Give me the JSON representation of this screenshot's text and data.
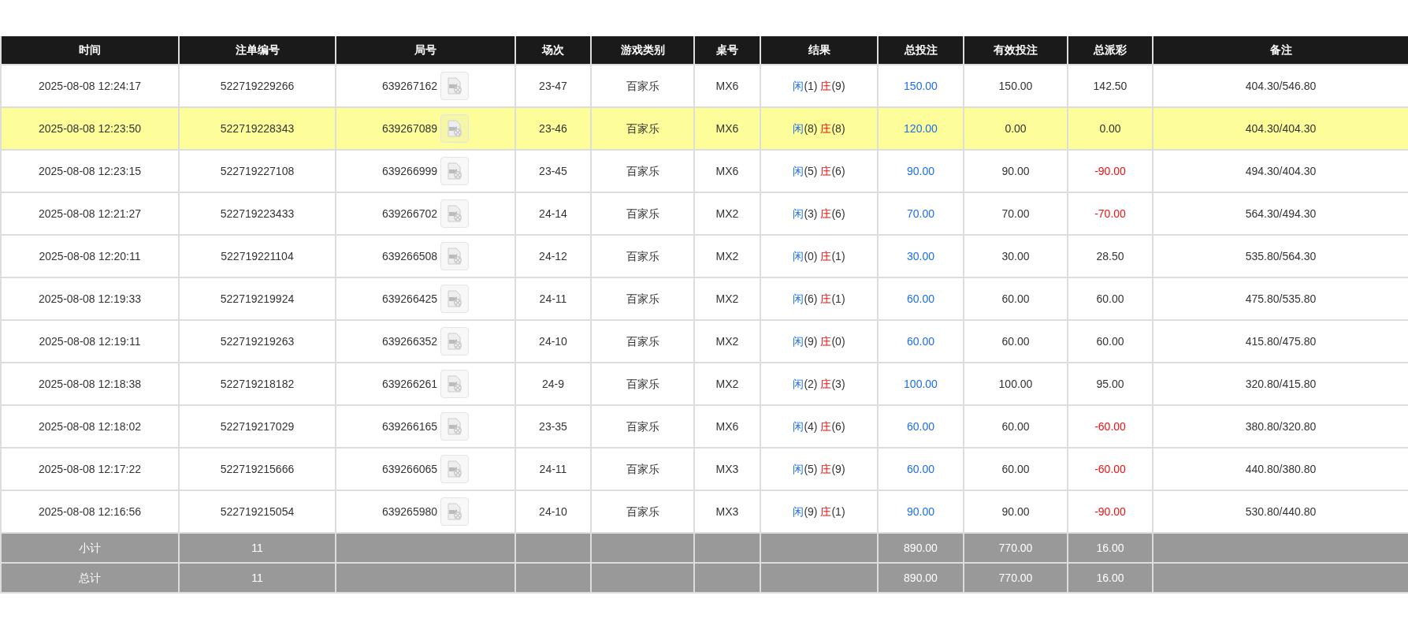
{
  "table": {
    "columns": [
      "时间",
      "注单编号",
      "局号",
      "场次",
      "游戏类别",
      "桌号",
      "结果",
      "总投注",
      "有效投注",
      "总派彩",
      "备注"
    ],
    "rows": [
      {
        "selected": false,
        "time": "2025-08-08 12:24:17",
        "bet_no": "522719229266",
        "round_no": "639267162",
        "session": "23-47",
        "game": "百家乐",
        "table": "MX6",
        "player": {
          "label": "闲",
          "score": "(1)"
        },
        "banker": {
          "label": "庄",
          "score": "(9)"
        },
        "total_bet": "150.00",
        "valid_bet": "150.00",
        "payout": "142.50",
        "payout_negative": false,
        "remark": "404.30/546.80"
      },
      {
        "selected": true,
        "time": "2025-08-08 12:23:50",
        "bet_no": "522719228343",
        "round_no": "639267089",
        "session": "23-46",
        "game": "百家乐",
        "table": "MX6",
        "player": {
          "label": "闲",
          "score": "(8)"
        },
        "banker": {
          "label": "庄",
          "score": "(8)"
        },
        "total_bet": "120.00",
        "valid_bet": "0.00",
        "payout": "0.00",
        "payout_negative": false,
        "remark": "404.30/404.30"
      },
      {
        "selected": false,
        "time": "2025-08-08 12:23:15",
        "bet_no": "522719227108",
        "round_no": "639266999",
        "session": "23-45",
        "game": "百家乐",
        "table": "MX6",
        "player": {
          "label": "闲",
          "score": "(5)"
        },
        "banker": {
          "label": "庄",
          "score": "(6)"
        },
        "total_bet": "90.00",
        "valid_bet": "90.00",
        "payout": "-90.00",
        "payout_negative": true,
        "remark": "494.30/404.30"
      },
      {
        "selected": false,
        "time": "2025-08-08 12:21:27",
        "bet_no": "522719223433",
        "round_no": "639266702",
        "session": "24-14",
        "game": "百家乐",
        "table": "MX2",
        "player": {
          "label": "闲",
          "score": "(3)"
        },
        "banker": {
          "label": "庄",
          "score": "(6)"
        },
        "total_bet": "70.00",
        "valid_bet": "70.00",
        "payout": "-70.00",
        "payout_negative": true,
        "remark": "564.30/494.30"
      },
      {
        "selected": false,
        "time": "2025-08-08 12:20:11",
        "bet_no": "522719221104",
        "round_no": "639266508",
        "session": "24-12",
        "game": "百家乐",
        "table": "MX2",
        "player": {
          "label": "闲",
          "score": "(0)"
        },
        "banker": {
          "label": "庄",
          "score": "(1)"
        },
        "total_bet": "30.00",
        "valid_bet": "30.00",
        "payout": "28.50",
        "payout_negative": false,
        "remark": "535.80/564.30"
      },
      {
        "selected": false,
        "time": "2025-08-08 12:19:33",
        "bet_no": "522719219924",
        "round_no": "639266425",
        "session": "24-11",
        "game": "百家乐",
        "table": "MX2",
        "player": {
          "label": "闲",
          "score": "(6)"
        },
        "banker": {
          "label": "庄",
          "score": "(1)"
        },
        "total_bet": "60.00",
        "valid_bet": "60.00",
        "payout": "60.00",
        "payout_negative": false,
        "remark": "475.80/535.80"
      },
      {
        "selected": false,
        "time": "2025-08-08 12:19:11",
        "bet_no": "522719219263",
        "round_no": "639266352",
        "session": "24-10",
        "game": "百家乐",
        "table": "MX2",
        "player": {
          "label": "闲",
          "score": "(9)"
        },
        "banker": {
          "label": "庄",
          "score": "(0)"
        },
        "total_bet": "60.00",
        "valid_bet": "60.00",
        "payout": "60.00",
        "payout_negative": false,
        "remark": "415.80/475.80"
      },
      {
        "selected": false,
        "time": "2025-08-08 12:18:38",
        "bet_no": "522719218182",
        "round_no": "639266261",
        "session": "24-9",
        "game": "百家乐",
        "table": "MX2",
        "player": {
          "label": "闲",
          "score": "(2)"
        },
        "banker": {
          "label": "庄",
          "score": "(3)"
        },
        "total_bet": "100.00",
        "valid_bet": "100.00",
        "payout": "95.00",
        "payout_negative": false,
        "remark": "320.80/415.80"
      },
      {
        "selected": false,
        "time": "2025-08-08 12:18:02",
        "bet_no": "522719217029",
        "round_no": "639266165",
        "session": "23-35",
        "game": "百家乐",
        "table": "MX6",
        "player": {
          "label": "闲",
          "score": "(4)"
        },
        "banker": {
          "label": "庄",
          "score": "(6)"
        },
        "total_bet": "60.00",
        "valid_bet": "60.00",
        "payout": "-60.00",
        "payout_negative": true,
        "remark": "380.80/320.80"
      },
      {
        "selected": false,
        "time": "2025-08-08 12:17:22",
        "bet_no": "522719215666",
        "round_no": "639266065",
        "session": "24-11",
        "game": "百家乐",
        "table": "MX3",
        "player": {
          "label": "闲",
          "score": "(5)"
        },
        "banker": {
          "label": "庄",
          "score": "(9)"
        },
        "total_bet": "60.00",
        "valid_bet": "60.00",
        "payout": "-60.00",
        "payout_negative": true,
        "remark": "440.80/380.80"
      },
      {
        "selected": false,
        "time": "2025-08-08 12:16:56",
        "bet_no": "522719215054",
        "round_no": "639265980",
        "session": "24-10",
        "game": "百家乐",
        "table": "MX3",
        "player": {
          "label": "闲",
          "score": "(9)"
        },
        "banker": {
          "label": "庄",
          "score": "(1)"
        },
        "total_bet": "90.00",
        "valid_bet": "90.00",
        "payout": "-90.00",
        "payout_negative": true,
        "remark": "530.80/440.80"
      }
    ],
    "totals": [
      {
        "label": "小计",
        "count": "11",
        "total_bet": "890.00",
        "valid_bet": "770.00",
        "payout": "16.00"
      },
      {
        "label": "总计",
        "count": "11",
        "total_bet": "890.00",
        "valid_bet": "770.00",
        "payout": "16.00"
      }
    ]
  }
}
